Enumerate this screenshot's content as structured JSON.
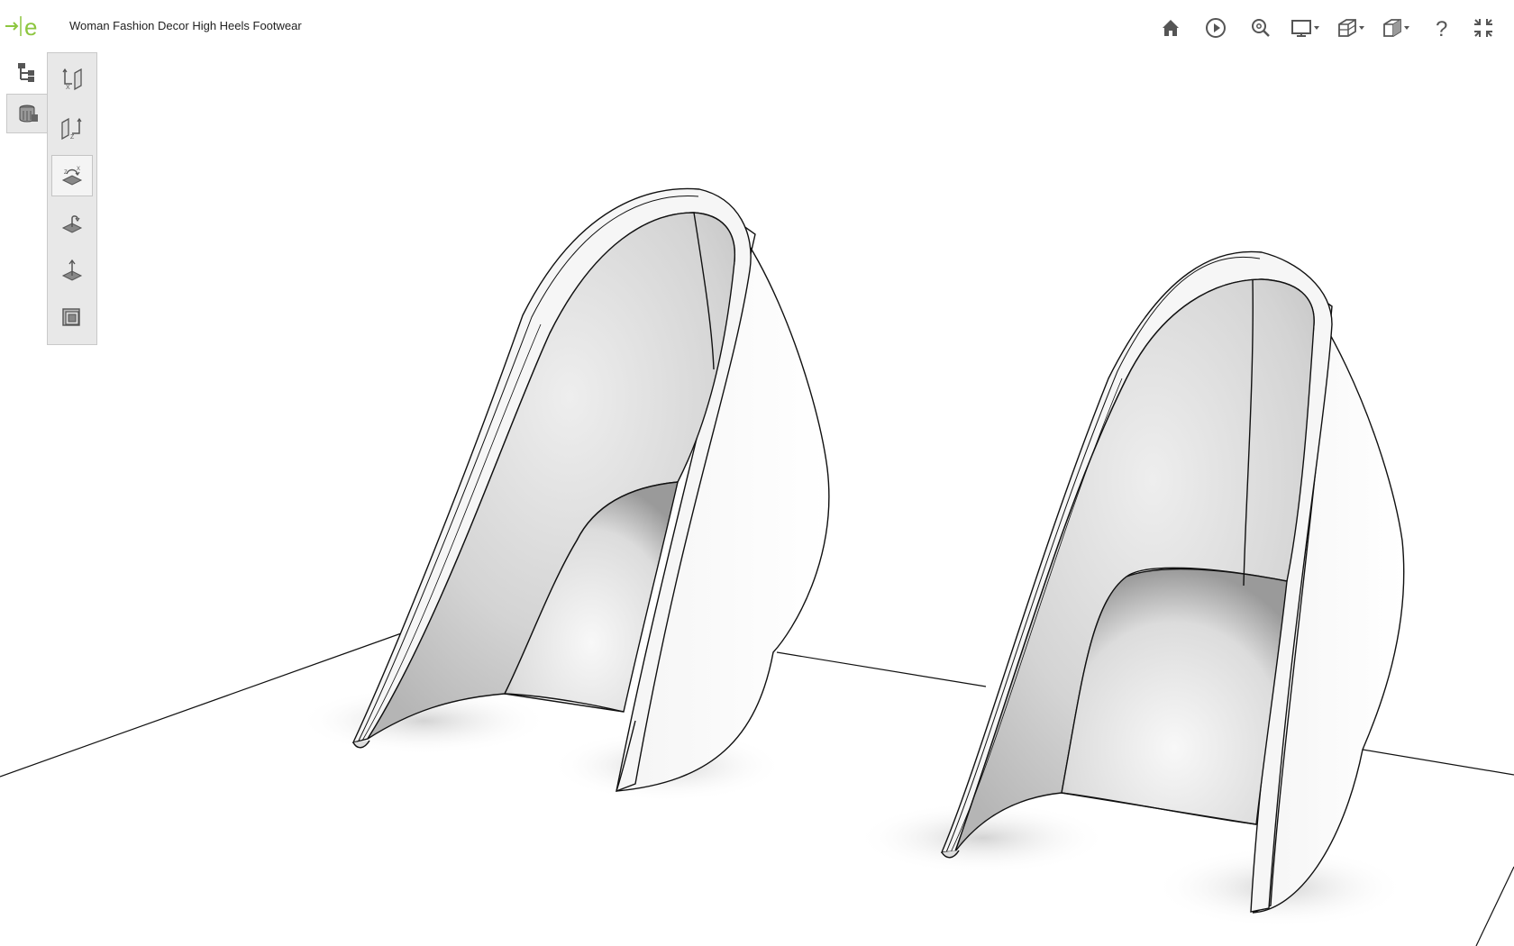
{
  "app": {
    "logo_icon": "edrawings-logo-icon",
    "logo_color": "#8dc63f"
  },
  "document": {
    "title": "Woman Fashion Decor High Heels Footwear"
  },
  "top_toolbar": [
    {
      "name": "home-icon"
    },
    {
      "name": "play-icon"
    },
    {
      "name": "zoom-icon"
    },
    {
      "name": "display-style-icon"
    },
    {
      "name": "section-view-icon"
    },
    {
      "name": "view-orientation-icon"
    },
    {
      "name": "help-icon"
    },
    {
      "name": "exit-fullscreen-icon"
    }
  ],
  "left_panel": {
    "tabs": [
      {
        "name": "model-tree-icon"
      },
      {
        "name": "configurations-icon"
      }
    ],
    "tools": [
      {
        "name": "move-axis-icon"
      },
      {
        "name": "rotate-axis-icon"
      },
      {
        "name": "rotate-plane-icon",
        "active": true
      },
      {
        "name": "flip-plane-icon"
      },
      {
        "name": "normal-arrow-icon"
      },
      {
        "name": "cap-section-icon"
      }
    ]
  },
  "colors": {
    "panel_bg": "#e8e8e8",
    "panel_border": "#c9c9c9",
    "icon": "#555555"
  }
}
